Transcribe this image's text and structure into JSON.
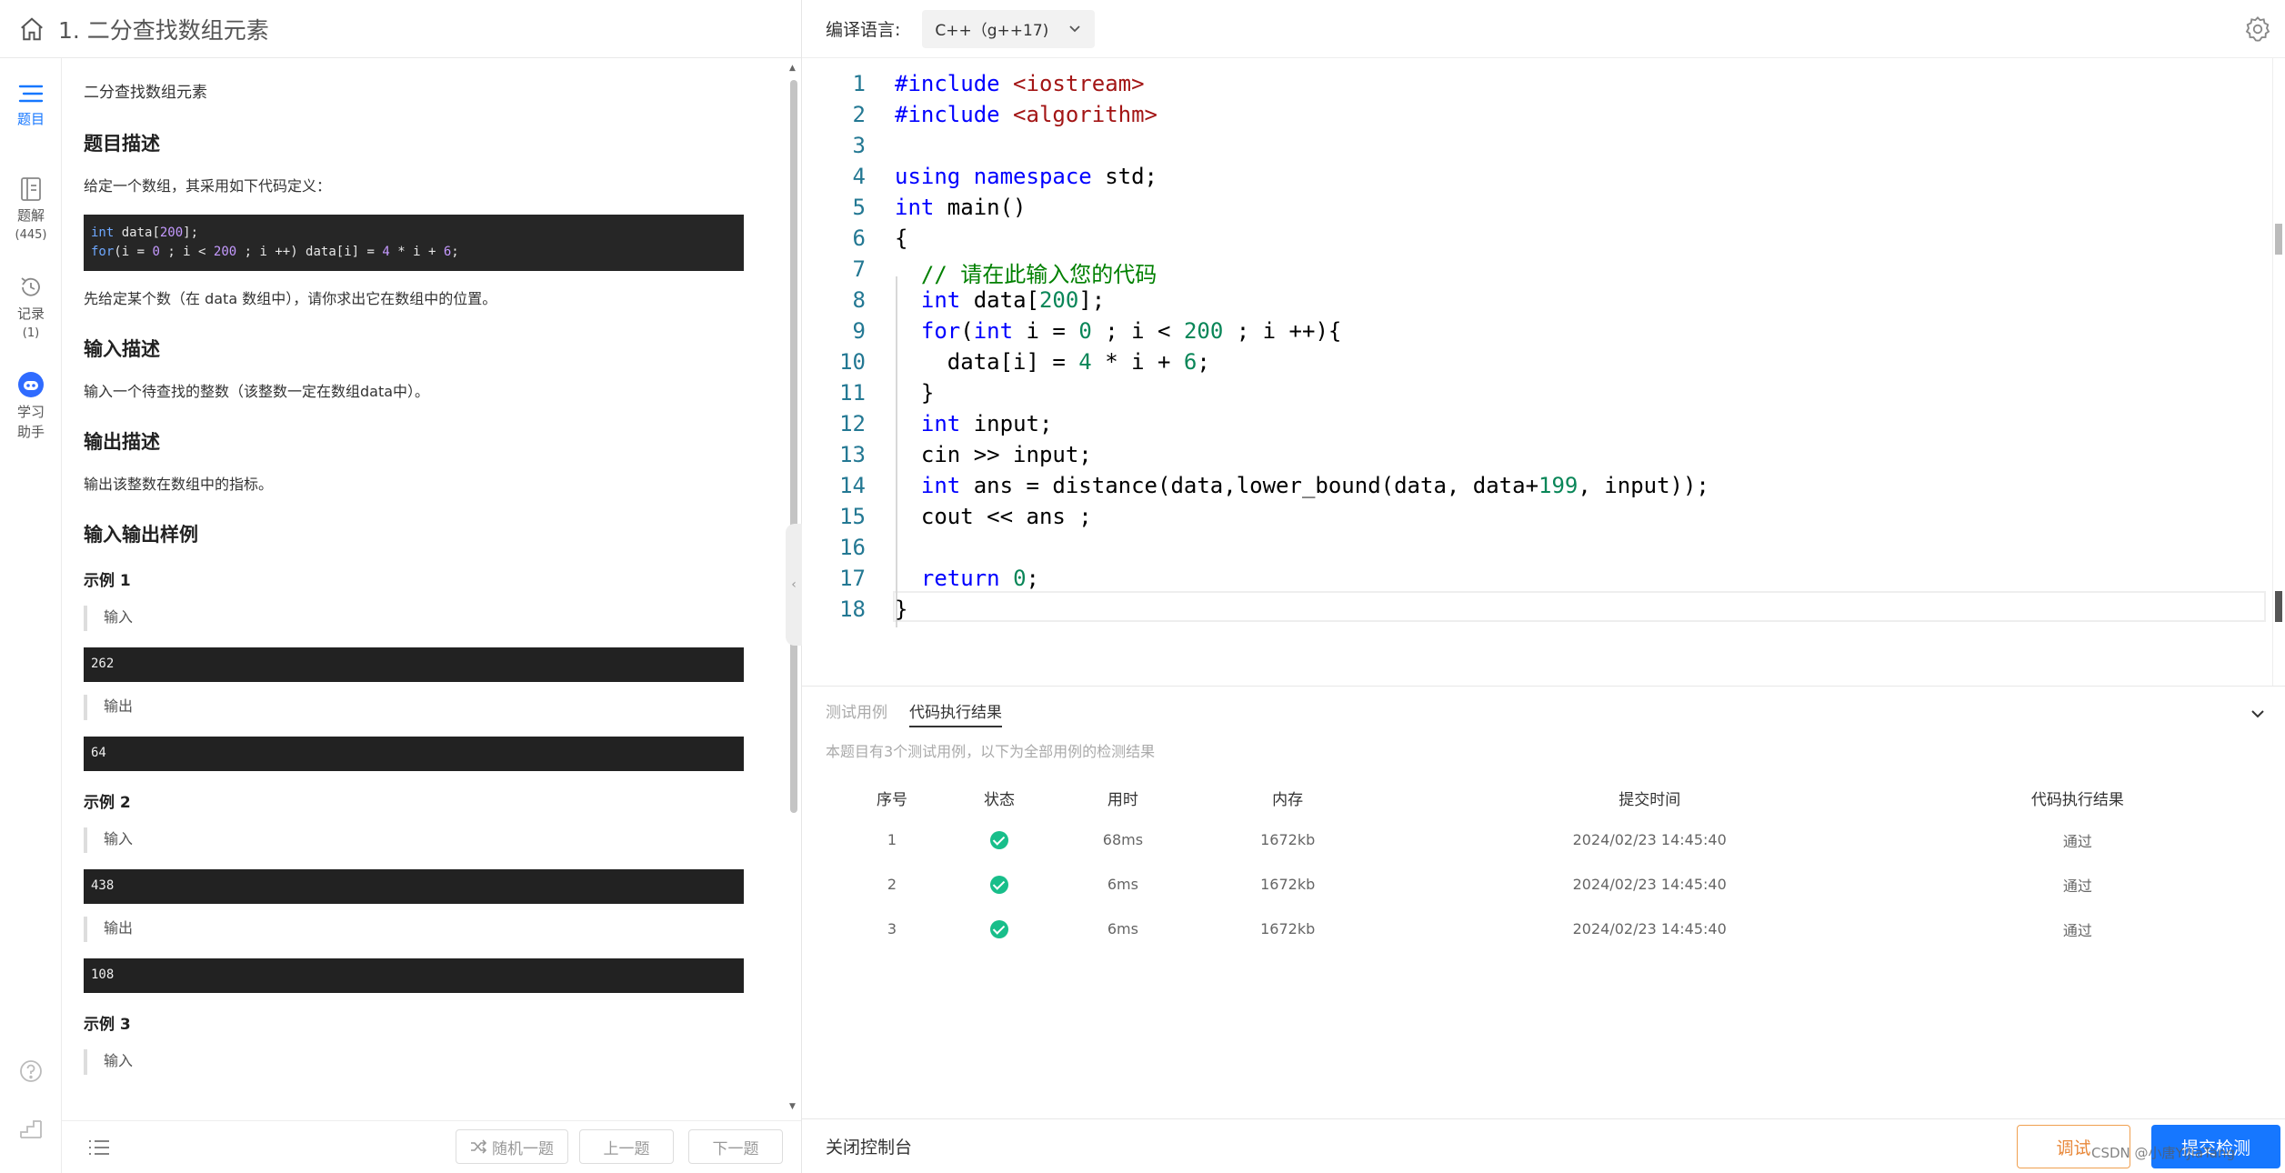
{
  "header": {
    "title": "1. 二分查找数组元素"
  },
  "rail": {
    "items": [
      {
        "label": "题目",
        "count": ""
      },
      {
        "label": "题解",
        "count": "(445)"
      },
      {
        "label": "记录",
        "count": "(1)"
      },
      {
        "label": "学习\n助手",
        "count": ""
      }
    ]
  },
  "problem": {
    "name": "二分查找数组元素",
    "desc_heading": "题目描述",
    "desc_text": "给定一个数组，其采用如下代码定义：",
    "code_lines": [
      "int data[200];",
      "for(i = 0 ; i < 200 ; i ++) data[i] = 4 * i + 6;"
    ],
    "desc_text2": "先给定某个数（在 data 数组中），请你求出它在数组中的位置。",
    "input_heading": "输入描述",
    "input_text": "输入一个待查找的整数（该整数一定在数组data中）。",
    "output_heading": "输出描述",
    "output_text": "输出该整数在数组中的指标。",
    "samples_heading": "输入输出样例",
    "samples": [
      {
        "title": "示例 1",
        "in_label": "输入",
        "in": "262",
        "out_label": "输出",
        "out": "64"
      },
      {
        "title": "示例 2",
        "in_label": "输入",
        "in": "438",
        "out_label": "输出",
        "out": "108"
      },
      {
        "title": "示例 3",
        "in_label": "输入"
      }
    ]
  },
  "footer": {
    "random": "随机一题",
    "prev": "上一题",
    "next": "下一题"
  },
  "editor": {
    "lang_label": "编译语言:",
    "lang_value": "C++（g++17)",
    "line_numbers": [
      "1",
      "2",
      "3",
      "4",
      "5",
      "6",
      "7",
      "8",
      "9",
      "10",
      "11",
      "12",
      "13",
      "14",
      "15",
      "16",
      "17",
      "18"
    ]
  },
  "console": {
    "tab_tests": "测试用例",
    "tab_result": "代码执行结果",
    "note": "本题目有3个测试用例，以下为全部用例的检测结果",
    "columns": [
      "序号",
      "状态",
      "用时",
      "内存",
      "提交时间",
      "代码执行结果"
    ],
    "rows": [
      {
        "idx": "1",
        "time": "68ms",
        "mem": "1672kb",
        "submitted": "2024/02/23 14:45:40",
        "result": "通过"
      },
      {
        "idx": "2",
        "time": "6ms",
        "mem": "1672kb",
        "submitted": "2024/02/23 14:45:40",
        "result": "通过"
      },
      {
        "idx": "3",
        "time": "6ms",
        "mem": "1672kb",
        "submitted": "2024/02/23 14:45:40",
        "result": "通过"
      }
    ]
  },
  "bottom": {
    "close_console": "关闭控制台",
    "debug": "调试",
    "submit": "提交检测"
  },
  "watermark": "CSDN @小唐YiJiaTang",
  "colors": {
    "accent": "#1677ff",
    "pass": "#18be8a",
    "debug": "#e8883a"
  }
}
